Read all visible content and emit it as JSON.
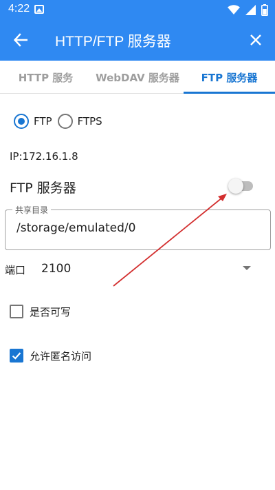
{
  "status_bar": {
    "time": "4:22"
  },
  "app_bar": {
    "title": "HTTP/FTP 服务器"
  },
  "tabs": [
    {
      "label": "HTTP 服务",
      "selected": false
    },
    {
      "label": "WebDAV 服务器",
      "selected": false
    },
    {
      "label": "FTP 服务器",
      "selected": true
    }
  ],
  "protocol": {
    "options": [
      {
        "label": "FTP",
        "selected": true
      },
      {
        "label": "FTPS",
        "selected": false
      }
    ]
  },
  "ip": "IP:172.16.1.8",
  "server_switch": {
    "label": "FTP 服务器",
    "on": false
  },
  "shared_dir": {
    "legend": "共享目录",
    "value": "/storage/emulated/0"
  },
  "port": {
    "label": "端口",
    "value": "2100"
  },
  "writable": {
    "label": "是否可写",
    "checked": false
  },
  "anonymous": {
    "label": "允许匿名访问",
    "checked": true
  },
  "colors": {
    "primary": "#2f89f2",
    "accent": "#1976d2",
    "annotation_arrow": "#d32f2f"
  },
  "icons": [
    "image-icon",
    "wifi-icon",
    "signal-icon",
    "battery-icon",
    "back-arrow-icon",
    "close-icon",
    "dropdown-arrow-icon",
    "check-icon"
  ]
}
